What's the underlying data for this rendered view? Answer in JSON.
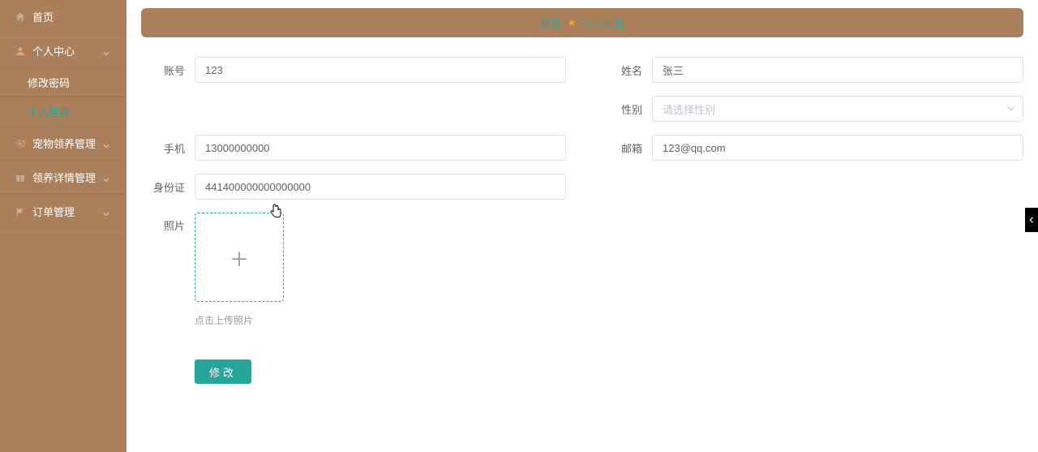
{
  "sidebar": {
    "items": [
      {
        "label": "首页",
        "icon": "home-icon",
        "expandable": false,
        "active": false
      },
      {
        "label": "个人中心",
        "icon": "user-icon",
        "expandable": true,
        "active": false,
        "children": [
          {
            "label": "修改密码",
            "active": false
          },
          {
            "label": "个人信息",
            "active": true
          }
        ]
      },
      {
        "label": "宠物领养管理",
        "icon": "cog-icon",
        "expandable": true,
        "active": false
      },
      {
        "label": "领养详情管理",
        "icon": "gift-icon",
        "expandable": true,
        "active": false
      },
      {
        "label": "订单管理",
        "icon": "flag-icon",
        "expandable": true,
        "active": false
      }
    ]
  },
  "breadcrumb": {
    "home": "首页",
    "current": "个人信息"
  },
  "form": {
    "account": {
      "label": "账号",
      "value": "123"
    },
    "name": {
      "label": "姓名",
      "value": "张三"
    },
    "gender": {
      "label": "性别",
      "placeholder": "请选择性别"
    },
    "phone": {
      "label": "手机",
      "value": "13000000000"
    },
    "email": {
      "label": "邮箱",
      "value": "123@qq.com"
    },
    "idcard": {
      "label": "身份证",
      "value": "441400000000000000"
    },
    "photo": {
      "label": "照片",
      "hint": "点击上传照片"
    },
    "submit": {
      "label": "修改"
    }
  }
}
